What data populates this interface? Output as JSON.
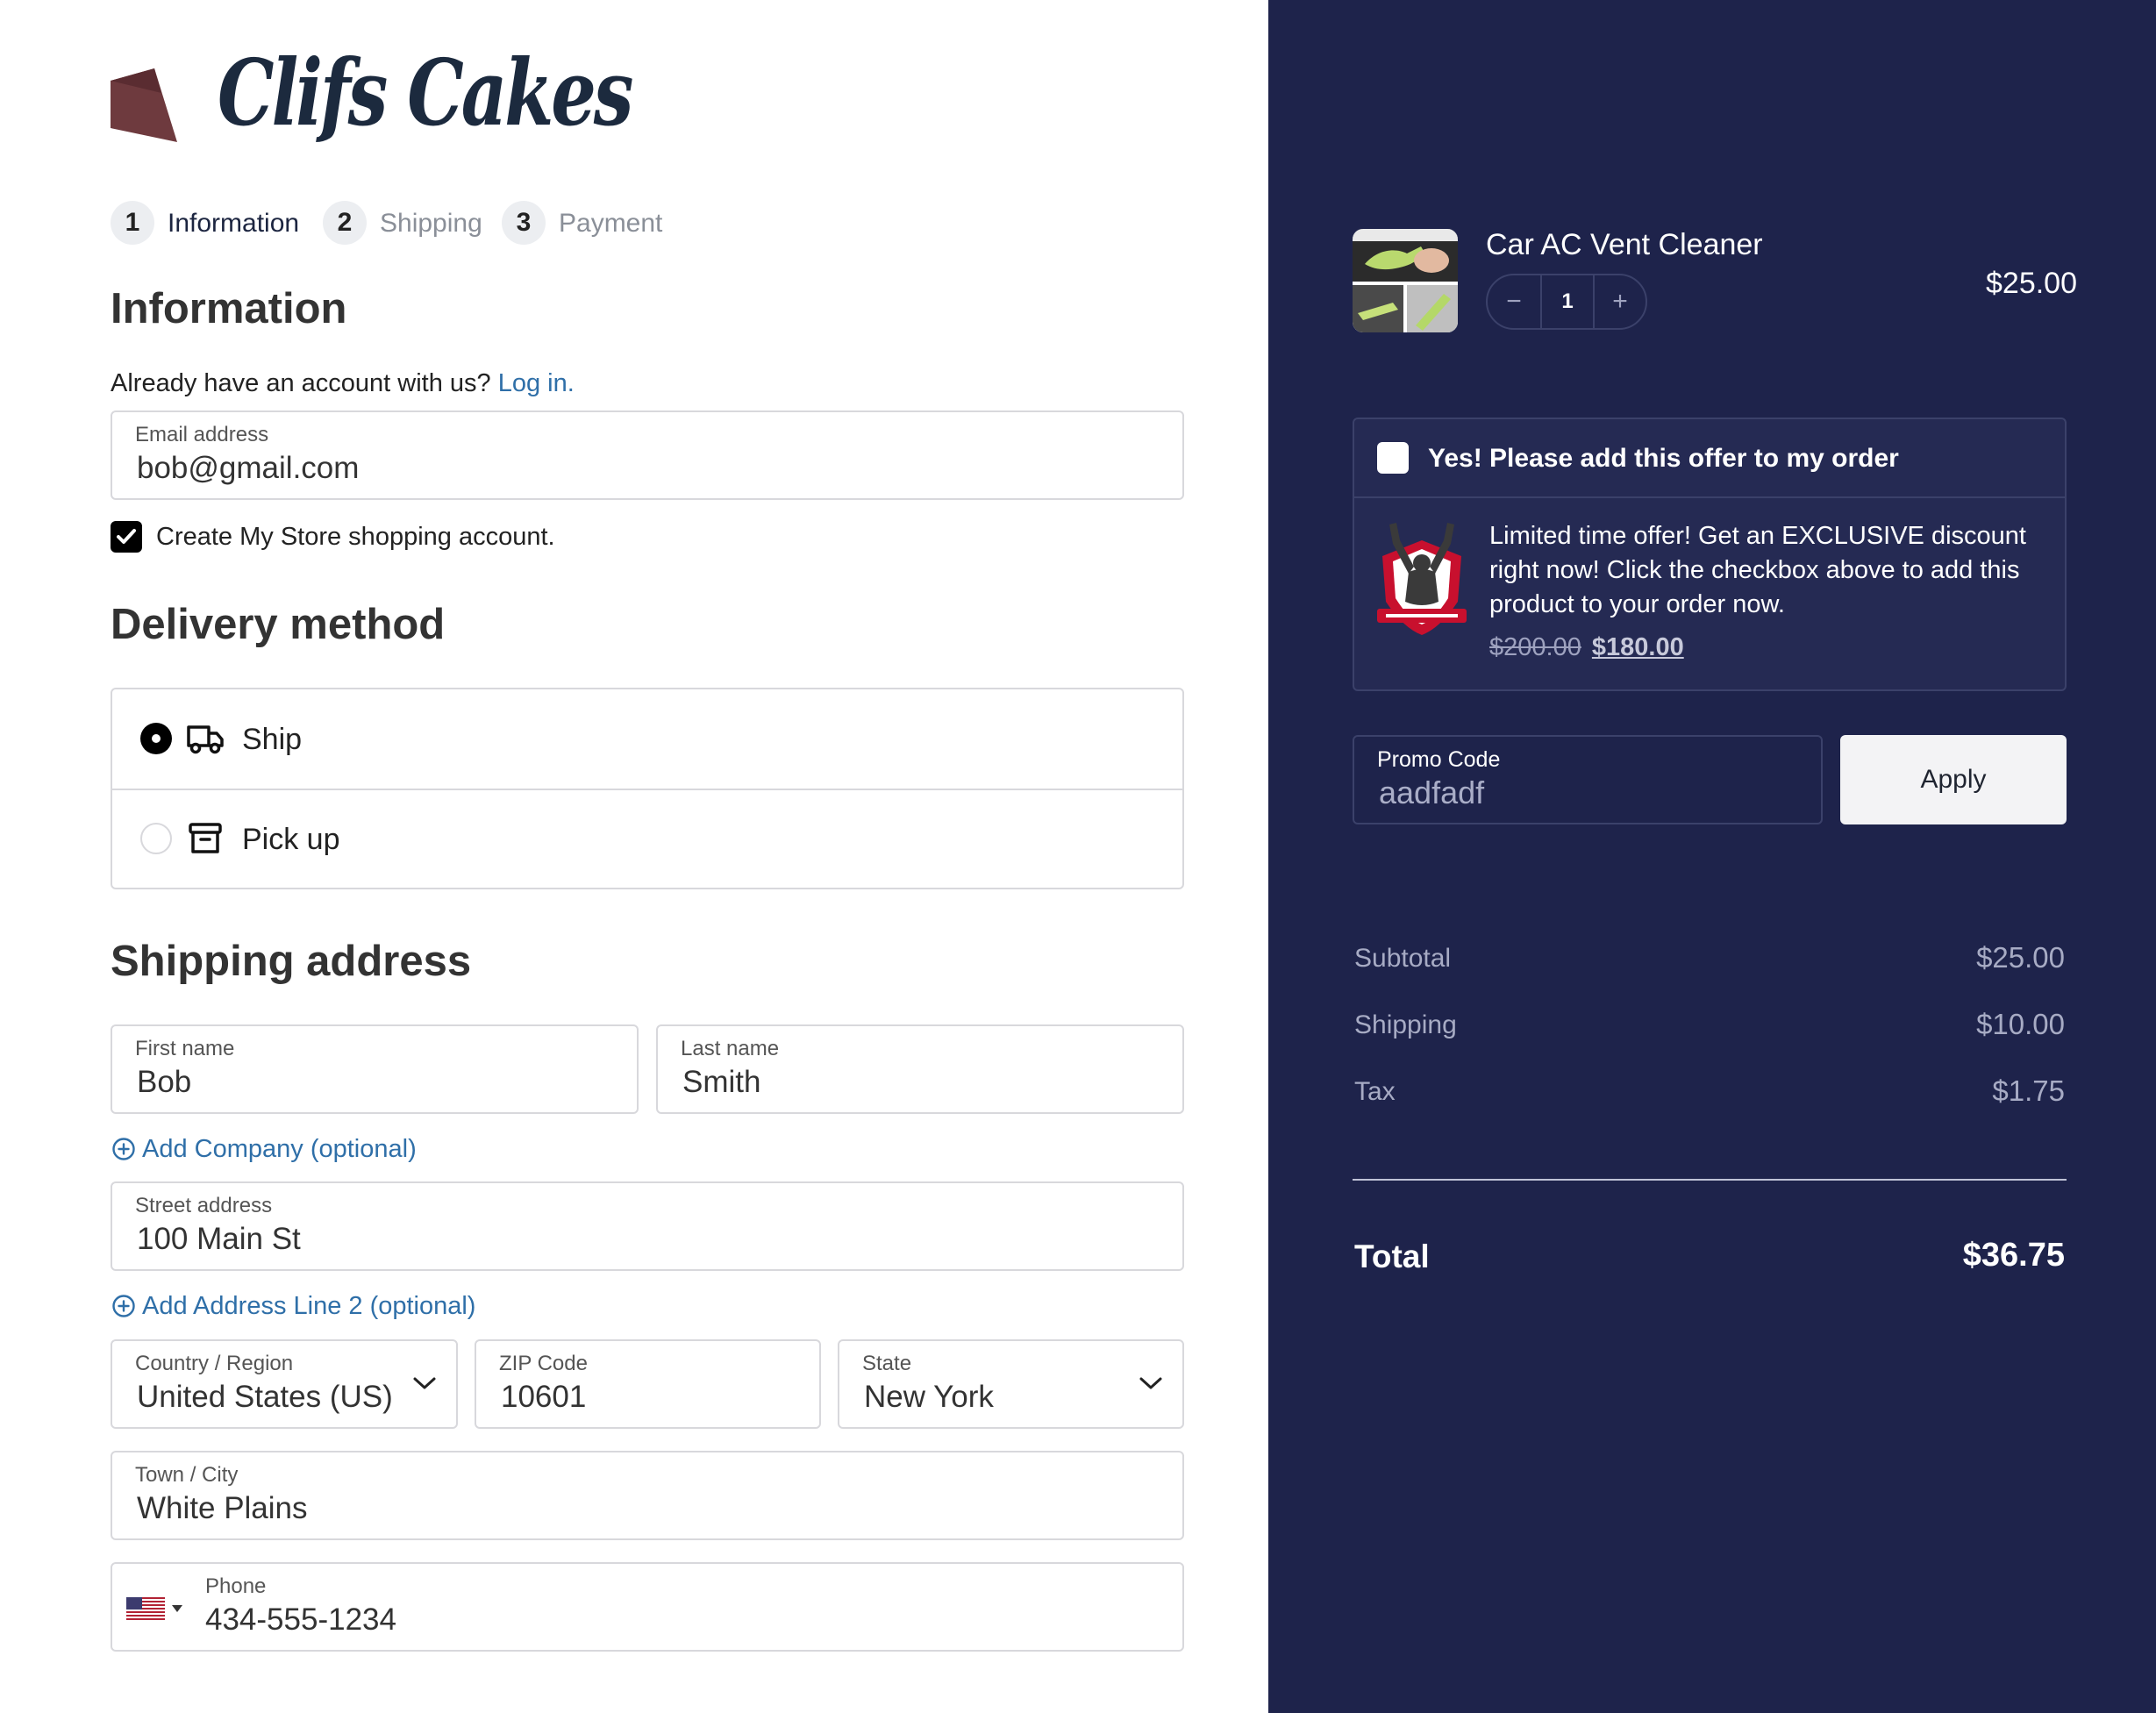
{
  "brand": {
    "name": "Clifs Cakes"
  },
  "steps": [
    {
      "num": "1",
      "label": "Information",
      "state": "active"
    },
    {
      "num": "2",
      "label": "Shipping",
      "state": "inactive"
    },
    {
      "num": "3",
      "label": "Payment",
      "state": "inactive"
    }
  ],
  "information": {
    "heading": "Information",
    "account_prompt": "Already have an account with us?",
    "login_link": "Log in.",
    "email": {
      "label": "Email address",
      "value": "bob@gmail.com"
    },
    "create_account": {
      "label": "Create My Store shopping account.",
      "checked": true
    }
  },
  "delivery": {
    "heading": "Delivery method",
    "options": [
      {
        "label": "Ship",
        "icon": "truck-icon",
        "selected": true
      },
      {
        "label": "Pick up",
        "icon": "archive-box-icon",
        "selected": false
      }
    ]
  },
  "shipping": {
    "heading": "Shipping address",
    "first_name": {
      "label": "First name",
      "value": "Bob"
    },
    "last_name": {
      "label": "Last name",
      "value": "Smith"
    },
    "add_company": "Add Company (optional)",
    "street": {
      "label": "Street address",
      "value": "100 Main St"
    },
    "add_line2": "Add Address Line 2 (optional)",
    "country": {
      "label": "Country / Region",
      "value": "United States (US)"
    },
    "zip": {
      "label": "ZIP Code",
      "value": "10601"
    },
    "state": {
      "label": "State",
      "value": "New York"
    },
    "city": {
      "label": "Town / City",
      "value": "White Plains"
    },
    "phone": {
      "label": "Phone",
      "value": "434-555-1234",
      "flag": "us-flag-icon"
    }
  },
  "cart": {
    "item": {
      "name": "Car AC Vent Cleaner",
      "quantity": "1",
      "price": "$25.00",
      "decrement": "−",
      "increment": "+"
    },
    "offer": {
      "checkbox_label": "Yes! Please add this offer to my order",
      "checked": false,
      "description": "Limited time offer! Get an EXCLUSIVE discount right now! Click the checkbox above to add this product to your order now.",
      "old_price": "$200.00",
      "new_price": "$180.00"
    },
    "promo": {
      "label": "Promo Code",
      "value": "aadfadf",
      "button": "Apply"
    },
    "summary": [
      {
        "label": "Subtotal",
        "value": "$25.00"
      },
      {
        "label": "Shipping",
        "value": "$10.00"
      },
      {
        "label": "Tax",
        "value": "$1.75"
      }
    ],
    "total": {
      "label": "Total",
      "value": "$36.75"
    }
  },
  "colors": {
    "sidebar_bg": "#1e234b",
    "link": "#2f6fa8",
    "brand_text": "#1c2a3e",
    "logo_mark": "#6e3a3e"
  }
}
